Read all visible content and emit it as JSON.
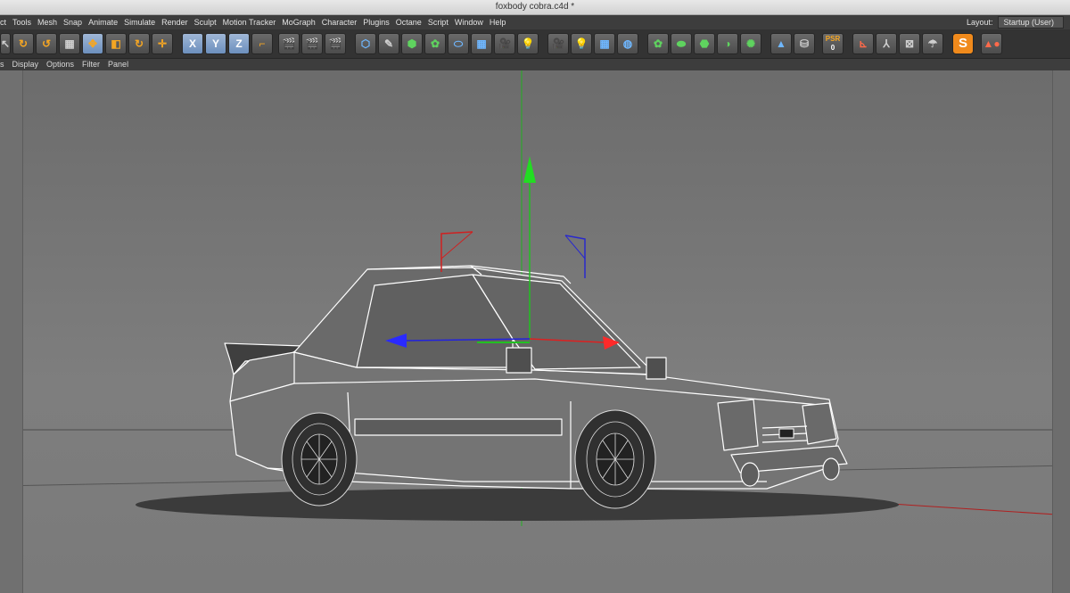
{
  "window": {
    "title": "foxbody cobra.c4d *"
  },
  "menu": {
    "items": [
      "ct",
      "Tools",
      "Mesh",
      "Snap",
      "Animate",
      "Simulate",
      "Render",
      "Sculpt",
      "Motion Tracker",
      "MoGraph",
      "Character",
      "Plugins",
      "Octane",
      "Script",
      "Window",
      "Help"
    ],
    "layout_label": "Layout:",
    "layout_value": "Startup (User)"
  },
  "toolbar": {
    "axis_x": "X",
    "axis_y": "Y",
    "axis_z": "Z",
    "psr_label": "PSR",
    "psr_value": "0",
    "plugin_label": "S"
  },
  "viewport_menu": {
    "items": [
      "s",
      "Display",
      "Options",
      "Filter",
      "Panel"
    ]
  },
  "colors": {
    "axis_x": "#e02020",
    "axis_y": "#20c020",
    "axis_z": "#2020e0",
    "wire": "#ffffff"
  }
}
